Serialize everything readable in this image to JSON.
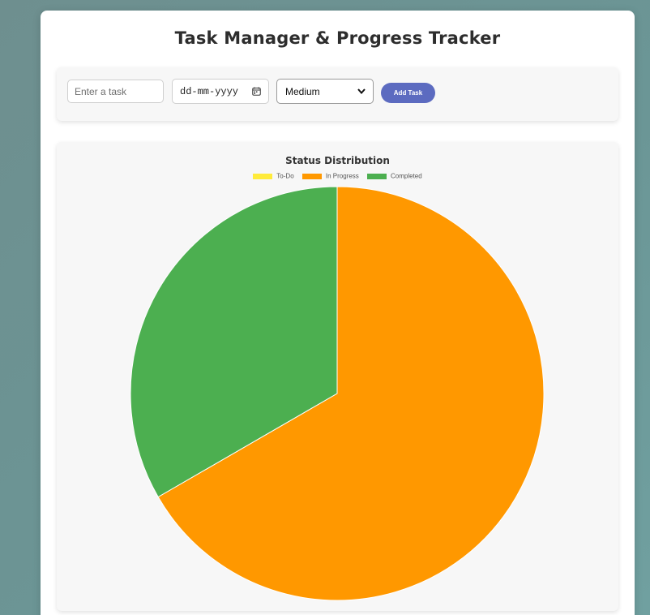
{
  "header": {
    "title": "Task Manager & Progress Tracker"
  },
  "form": {
    "task_placeholder": "Enter a task",
    "date_placeholder": "dd-mm-yyyy",
    "priority_selected": "Medium",
    "add_button_label": "Add Task"
  },
  "icons": {
    "date": "calendar-icon",
    "select": "chevron-down-icon"
  },
  "colors": {
    "accent": "#5c6bc0",
    "todo": "#ffeb3b",
    "in_progress": "#ff9800",
    "completed": "#4caf50"
  },
  "chart_data": {
    "type": "pie",
    "title": "Status Distribution",
    "categories": [
      "To-Do",
      "In Progress",
      "Completed"
    ],
    "values": [
      0,
      2,
      1
    ],
    "colors": [
      "#ffeb3b",
      "#ff9800",
      "#4caf50"
    ],
    "legend_position": "top"
  }
}
